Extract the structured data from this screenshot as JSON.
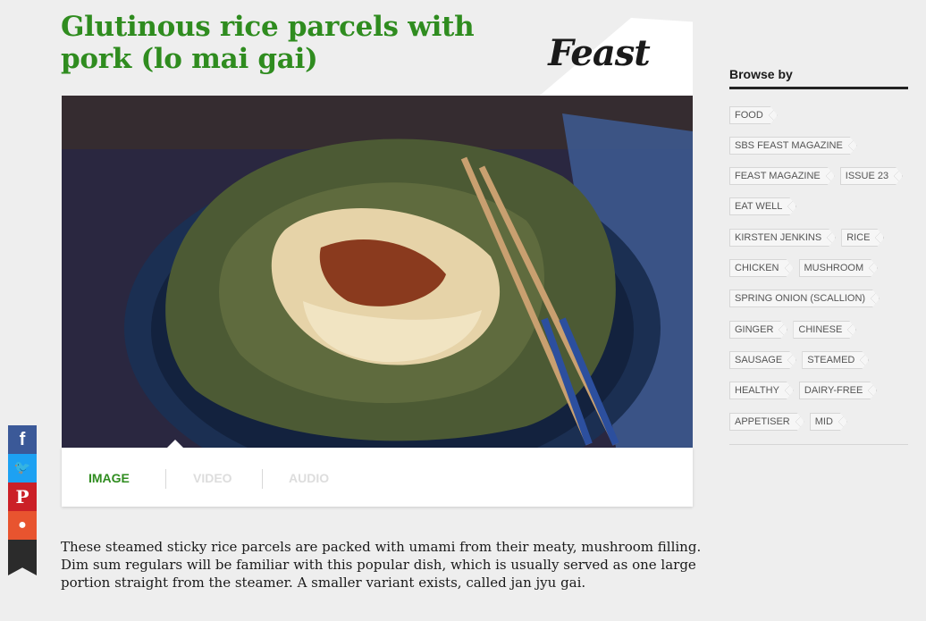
{
  "recipe": {
    "title": "Glutinous rice parcels with pork (lo mai gai)",
    "brand": "Feast",
    "description": "These steamed sticky rice parcels are packed with umami from their meaty, mushroom filling. Dim sum regulars will be familiar with this popular dish, which is usually served as one large portion straight from the steamer. A smaller variant exists, called jan jyu gai."
  },
  "media_tabs": [
    {
      "label": "IMAGE",
      "active": true
    },
    {
      "label": "VIDEO",
      "active": false
    },
    {
      "label": "AUDIO",
      "active": false
    }
  ],
  "social": {
    "facebook": "f",
    "twitter": "🐦",
    "pinterest": "P",
    "reddit": "●"
  },
  "browse": {
    "title": "Browse by",
    "rows": [
      [
        "FOOD"
      ],
      [
        "SBS FEAST MAGAZINE"
      ],
      [
        "FEAST MAGAZINE",
        "ISSUE 23"
      ],
      [
        "EAT WELL"
      ],
      [
        "KIRSTEN JENKINS",
        "RICE"
      ],
      [
        "CHICKEN",
        "MUSHROOM"
      ],
      [
        "SPRING ONION (SCALLION)"
      ],
      [
        "GINGER",
        "CHINESE"
      ],
      [
        "SAUSAGE",
        "STEAMED"
      ],
      [
        "HEALTHY",
        "DAIRY-FREE"
      ],
      [
        "APPETISER",
        "MID"
      ]
    ]
  },
  "colors": {
    "accent_green": "#2f8c1f",
    "facebook": "#3b5998",
    "twitter": "#1da1f2",
    "pinterest": "#cb2027",
    "reddit": "#e8542f"
  }
}
